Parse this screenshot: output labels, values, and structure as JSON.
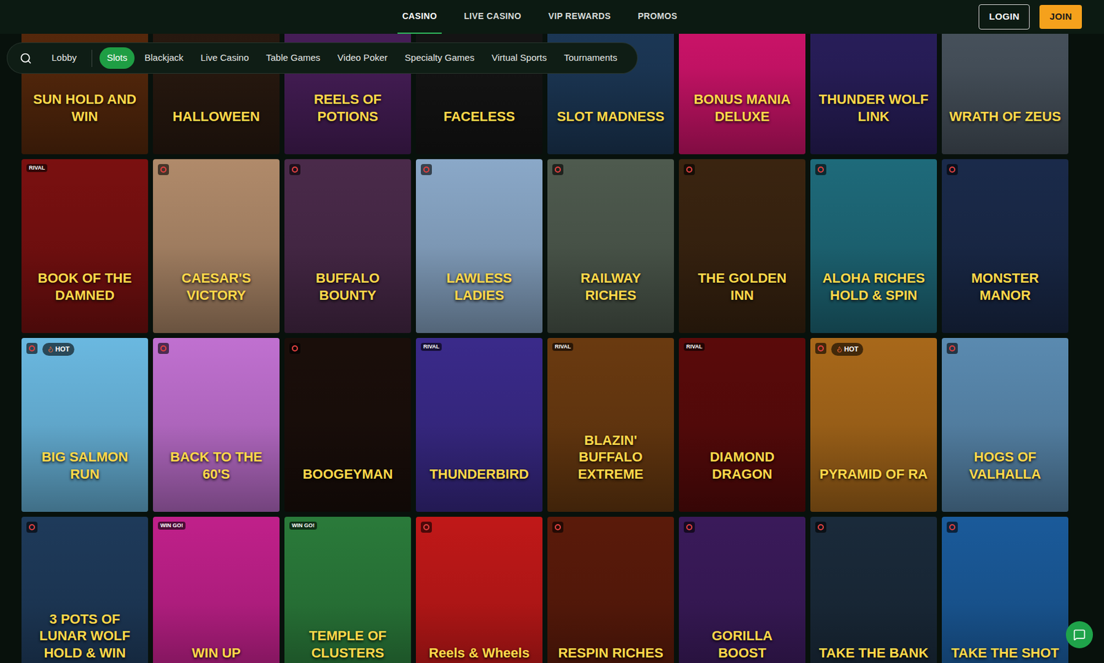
{
  "nav": {
    "items": [
      {
        "label": "CASINO",
        "selected": true
      },
      {
        "label": "LIVE CASINO",
        "selected": false
      },
      {
        "label": "VIP REWARDS",
        "selected": false
      },
      {
        "label": "PROMOS",
        "selected": false
      }
    ],
    "login": "LOGIN",
    "join": "JOIN"
  },
  "filters": [
    {
      "label": "Lobby",
      "selected": false
    },
    {
      "label": "Slots",
      "selected": true
    },
    {
      "label": "Blackjack",
      "selected": false
    },
    {
      "label": "Live Casino",
      "selected": false
    },
    {
      "label": "Table Games",
      "selected": false
    },
    {
      "label": "Video Poker",
      "selected": false
    },
    {
      "label": "Specialty Games",
      "selected": false
    },
    {
      "label": "Virtual Sports",
      "selected": false
    },
    {
      "label": "Tournaments",
      "selected": false
    }
  ],
  "games": [
    {
      "title": "SUN HOLD AND WIN",
      "provider": "",
      "providerIcon": false,
      "hot": false,
      "color": "#5a2a0c"
    },
    {
      "title": "HALLOWEEN",
      "provider": "",
      "providerIcon": false,
      "hot": false,
      "color": "#2a1a10"
    },
    {
      "title": "REELS OF POTIONS",
      "provider": "",
      "providerIcon": false,
      "hot": false,
      "color": "#4a1f5c"
    },
    {
      "title": "FACELESS",
      "provider": "",
      "providerIcon": false,
      "hot": false,
      "color": "#151515"
    },
    {
      "title": "SLOT MADNESS",
      "provider": "",
      "providerIcon": false,
      "hot": false,
      "color": "#1d3a5a"
    },
    {
      "title": "BONUS MANIA DELUXE",
      "provider": "",
      "providerIcon": false,
      "hot": false,
      "color": "#d6146e"
    },
    {
      "title": "THUNDER WOLF LINK",
      "provider": "",
      "providerIcon": false,
      "hot": false,
      "color": "#2a1f5e"
    },
    {
      "title": "WRATH OF ZEUS",
      "provider": "",
      "providerIcon": false,
      "hot": false,
      "color": "#4a5560"
    },
    {
      "title": "BOOK OF THE DAMNED",
      "provider": "RIVAL",
      "providerIcon": false,
      "hot": false,
      "color": "#7a1010"
    },
    {
      "title": "CAESAR'S VICTORY",
      "provider": "",
      "providerIcon": true,
      "hot": false,
      "color": "#b08a6a"
    },
    {
      "title": "BUFFALO BOUNTY",
      "provider": "",
      "providerIcon": true,
      "hot": false,
      "color": "#4a2a4a"
    },
    {
      "title": "LAWLESS LADIES",
      "provider": "",
      "providerIcon": true,
      "hot": false,
      "color": "#8aa8c8"
    },
    {
      "title": "RAILWAY RICHES",
      "provider": "",
      "providerIcon": true,
      "hot": false,
      "color": "#4e5a4e"
    },
    {
      "title": "THE GOLDEN INN",
      "provider": "",
      "providerIcon": true,
      "hot": false,
      "color": "#3a2410"
    },
    {
      "title": "ALOHA RICHES HOLD & SPIN",
      "provider": "",
      "providerIcon": true,
      "hot": false,
      "color": "#1e6a7a"
    },
    {
      "title": "MONSTER MANOR",
      "provider": "",
      "providerIcon": true,
      "hot": false,
      "color": "#1a2a4a"
    },
    {
      "title": "BIG SALMON RUN",
      "provider": "",
      "providerIcon": true,
      "hot": true,
      "color": "#6ab8e0"
    },
    {
      "title": "BACK TO THE 60'S",
      "provider": "",
      "providerIcon": true,
      "hot": false,
      "color": "#c070d0"
    },
    {
      "title": "BOOGEYMAN",
      "provider": "",
      "providerIcon": true,
      "hot": false,
      "color": "#1a0e0a"
    },
    {
      "title": "THUNDERBIRD",
      "provider": "RIVAL",
      "providerIcon": false,
      "hot": false,
      "color": "#3a2a8a"
    },
    {
      "title": "BLAZIN' BUFFALO EXTREME",
      "provider": "RIVAL",
      "providerIcon": false,
      "hot": false,
      "color": "#6a3a10"
    },
    {
      "title": "DIAMOND DRAGON",
      "provider": "RIVAL",
      "providerIcon": false,
      "hot": false,
      "color": "#5a0a0a"
    },
    {
      "title": "PYRAMID OF RA",
      "provider": "",
      "providerIcon": true,
      "hot": true,
      "color": "#a8681a"
    },
    {
      "title": "HOGS OF VALHALLA",
      "provider": "",
      "providerIcon": true,
      "hot": false,
      "color": "#5a8ab0"
    },
    {
      "title": "3 POTS OF LUNAR WOLF HOLD & WIN",
      "provider": "",
      "providerIcon": true,
      "hot": false,
      "color": "#1e3a5a"
    },
    {
      "title": "WIN UP",
      "provider": "WIN GO!",
      "providerIcon": false,
      "hot": false,
      "color": "#c0208a"
    },
    {
      "title": "TEMPLE OF CLUSTERS",
      "provider": "WIN GO!",
      "providerIcon": false,
      "hot": false,
      "color": "#2a7a3a"
    },
    {
      "title": "Reels & Wheels",
      "provider": "",
      "providerIcon": true,
      "hot": false,
      "color": "#c01818"
    },
    {
      "title": "RESPIN RICHES",
      "provider": "",
      "providerIcon": true,
      "hot": false,
      "color": "#5a1a0a"
    },
    {
      "title": "GORILLA BOOST",
      "provider": "",
      "providerIcon": true,
      "hot": false,
      "color": "#3a1a5a"
    },
    {
      "title": "TAKE THE BANK",
      "provider": "",
      "providerIcon": true,
      "hot": false,
      "color": "#1a2a3a"
    },
    {
      "title": "TAKE THE SHOT",
      "provider": "",
      "providerIcon": true,
      "hot": false,
      "color": "#1a5a9a"
    }
  ],
  "hotLabel": "HOT"
}
